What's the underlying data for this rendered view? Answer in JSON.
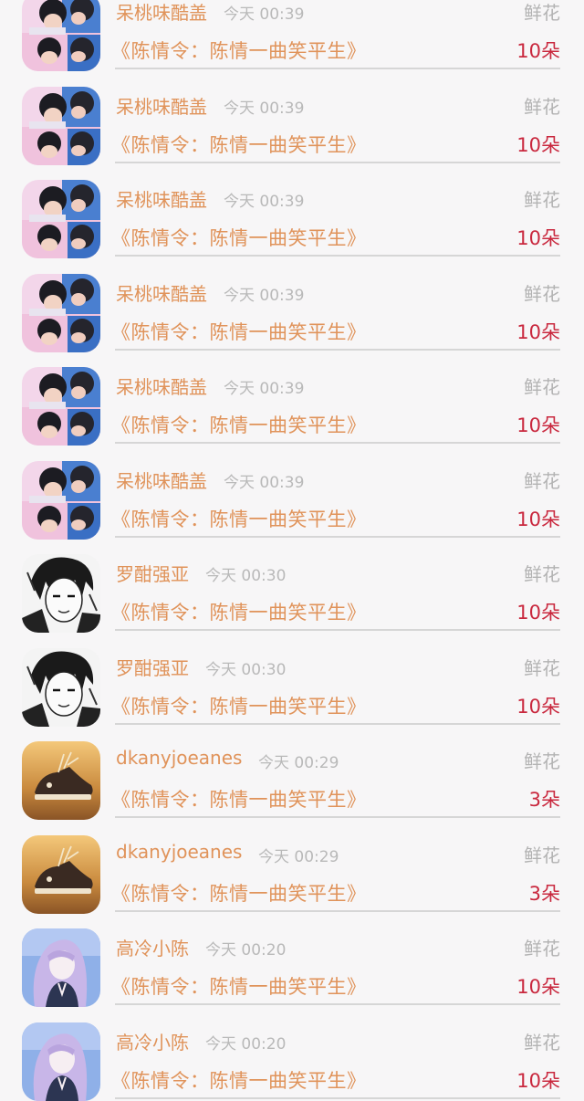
{
  "items": [
    {
      "name": "呆桃味酷盖",
      "time": "今天 00:39",
      "gift": "鲜花",
      "work": "《陈情令：陈情一曲笑平生》",
      "count": "10朵",
      "avatar": "avatar-couple-photo"
    },
    {
      "name": "呆桃味酷盖",
      "time": "今天 00:39",
      "gift": "鲜花",
      "work": "《陈情令：陈情一曲笑平生》",
      "count": "10朵",
      "avatar": "avatar-couple-photo"
    },
    {
      "name": "呆桃味酷盖",
      "time": "今天 00:39",
      "gift": "鲜花",
      "work": "《陈情令：陈情一曲笑平生》",
      "count": "10朵",
      "avatar": "avatar-couple-photo"
    },
    {
      "name": "呆桃味酷盖",
      "time": "今天 00:39",
      "gift": "鲜花",
      "work": "《陈情令：陈情一曲笑平生》",
      "count": "10朵",
      "avatar": "avatar-couple-photo"
    },
    {
      "name": "呆桃味酷盖",
      "time": "今天 00:39",
      "gift": "鲜花",
      "work": "《陈情令：陈情一曲笑平生》",
      "count": "10朵",
      "avatar": "avatar-couple-photo"
    },
    {
      "name": "呆桃味酷盖",
      "time": "今天 00:39",
      "gift": "鲜花",
      "work": "《陈情令：陈情一曲笑平生》",
      "count": "10朵",
      "avatar": "avatar-couple-photo"
    },
    {
      "name": "罗酣强亚",
      "time": "今天 00:30",
      "gift": "鲜花",
      "work": "《陈情令：陈情一曲笑平生》",
      "count": "10朵",
      "avatar": "avatar-manga-sketch"
    },
    {
      "name": "罗酣强亚",
      "time": "今天 00:30",
      "gift": "鲜花",
      "work": "《陈情令：陈情一曲笑平生》",
      "count": "10朵",
      "avatar": "avatar-manga-sketch"
    },
    {
      "name": "dkanyjoeanes",
      "time": "今天 00:29",
      "gift": "鲜花",
      "work": "《陈情令：陈情一曲笑平生》",
      "count": "3朵",
      "avatar": "avatar-sneaker-photo"
    },
    {
      "name": "dkanyjoeanes",
      "time": "今天 00:29",
      "gift": "鲜花",
      "work": "《陈情令：陈情一曲笑平生》",
      "count": "3朵",
      "avatar": "avatar-sneaker-photo"
    },
    {
      "name": "高冷小陈",
      "time": "今天 00:20",
      "gift": "鲜花",
      "work": "《陈情令：陈情一曲笑平生》",
      "count": "10朵",
      "avatar": "avatar-anime-girl"
    },
    {
      "name": "高冷小陈",
      "time": "今天 00:20",
      "gift": "鲜花",
      "work": "《陈情令：陈情一曲笑平生》",
      "count": "10朵",
      "avatar": "avatar-anime-girl"
    }
  ],
  "colors": {
    "name": "#e0935a",
    "time": "#b9b9b9",
    "gift": "#b3b3b3",
    "count": "#c9283e",
    "background": "#f7f6f7",
    "divider": "#d6d6d6"
  }
}
